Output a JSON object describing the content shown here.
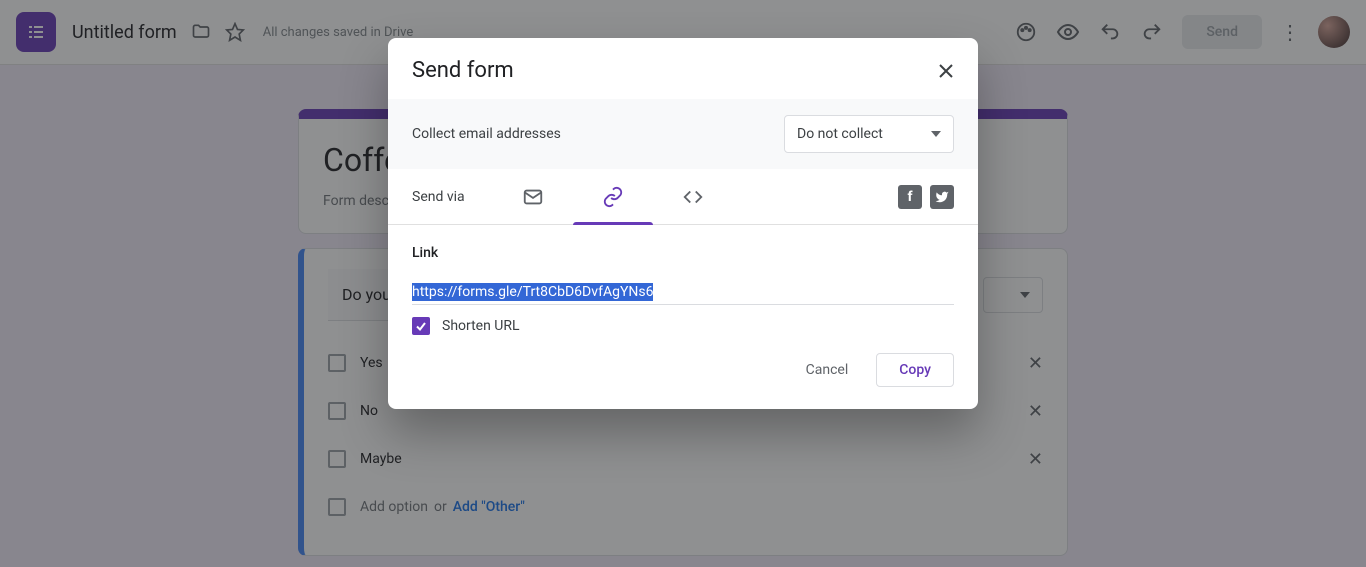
{
  "header": {
    "title": "Untitled form",
    "save_status": "All changes saved in Drive",
    "send_label": "Send"
  },
  "form": {
    "title": "Coffe",
    "description": "Form descr",
    "question_text": "Do you d",
    "options": [
      "Yes",
      "No",
      "Maybe"
    ],
    "add_option": "Add option",
    "or": "or",
    "add_other": "Add \"Other\""
  },
  "modal": {
    "title": "Send form",
    "collect_label": "Collect email addresses",
    "collect_value": "Do not collect",
    "send_via": "Send via",
    "link_heading": "Link",
    "link_value": "https://forms.gle/Trt8CbD6DvfAgYNs6",
    "shorten_label": "Shorten URL",
    "shorten_checked": true,
    "cancel": "Cancel",
    "copy": "Copy"
  }
}
